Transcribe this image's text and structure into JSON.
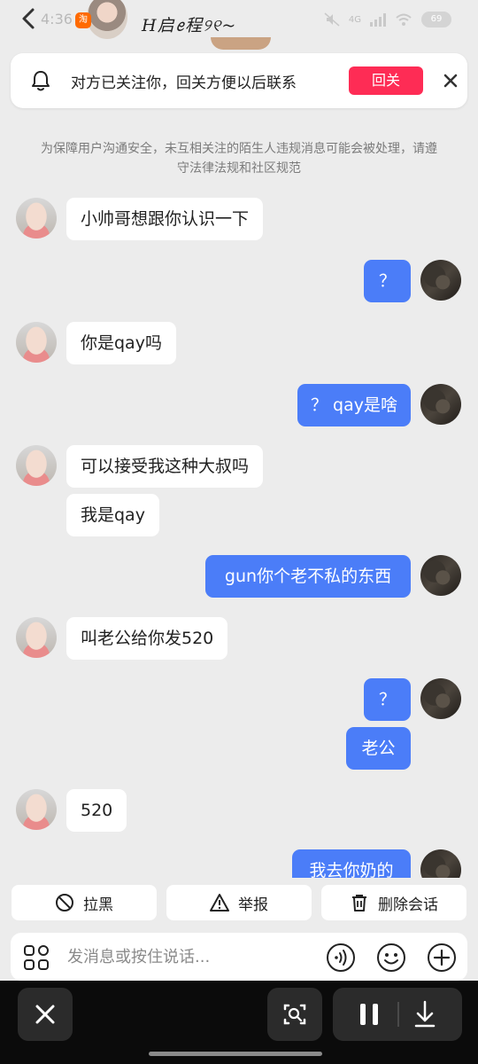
{
  "status": {
    "time": "4:36",
    "network": "4G",
    "battery": "69"
  },
  "header": {
    "contact_name": "H启ꫀ程୨୧~",
    "app_badge": "淘"
  },
  "follow_banner": {
    "text": "对方已关注你，回关方便以后联系",
    "button": "回关"
  },
  "notice": "为保障用户沟通安全，未互相关注的陌生人违规消息可能会被处理，请遵守法律法规和社区规范",
  "messages": [
    {
      "from": "them",
      "text": "小帅哥想跟你认识一下"
    },
    {
      "from": "me",
      "text": "？"
    },
    {
      "from": "them",
      "text": "你是qay吗"
    },
    {
      "from": "me",
      "text": "？ qay是啥"
    },
    {
      "from": "them",
      "text": "可以接受我这种大叔吗"
    },
    {
      "from": "them",
      "text": "我是qay"
    },
    {
      "from": "me",
      "text": "gun你个老不私的东西"
    },
    {
      "from": "them",
      "text": "叫老公给你发520"
    },
    {
      "from": "me",
      "text": "？"
    },
    {
      "from": "me",
      "text": "老公"
    },
    {
      "from": "them",
      "text": "520"
    },
    {
      "from": "me",
      "text": "我去你奶的"
    }
  ],
  "actions": {
    "block": "拉黑",
    "report": "举报",
    "delete": "删除会话"
  },
  "input": {
    "placeholder": "发消息或按住说话..."
  },
  "colors": {
    "accent_red": "#fe2c55",
    "bubble_blue": "#4b7df8"
  }
}
